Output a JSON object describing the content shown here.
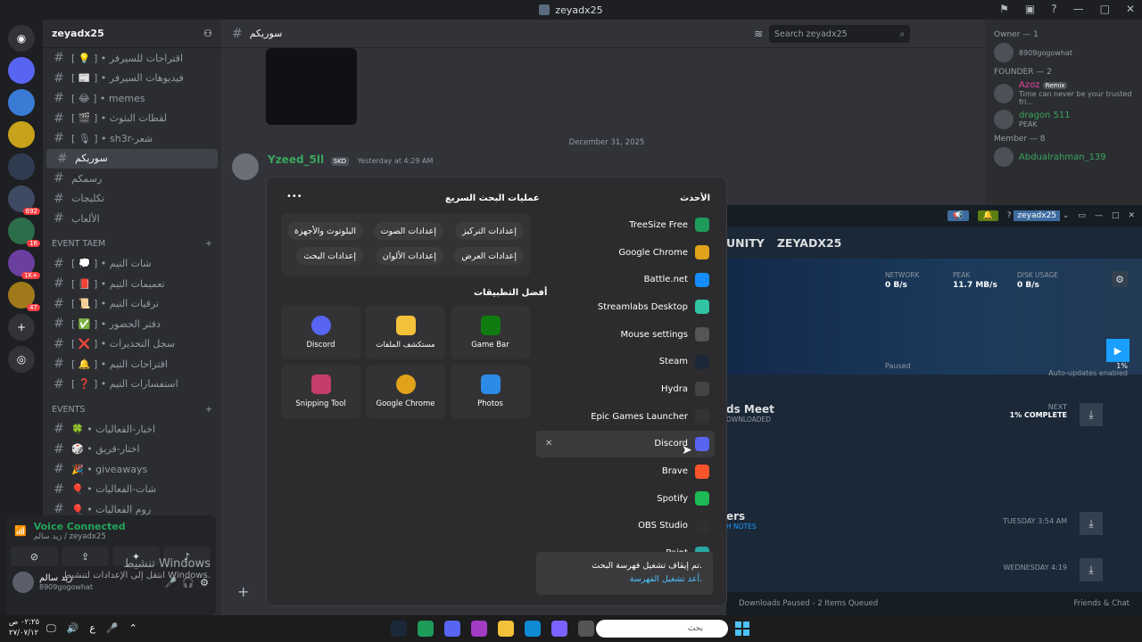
{
  "title_bar": {
    "title": "zeyadx25"
  },
  "guild": {
    "name": "zeyadx25"
  },
  "servers": [
    {
      "label": "",
      "badge": ""
    },
    {
      "label": "",
      "badge": ""
    },
    {
      "label": "",
      "badge": ""
    },
    {
      "label": "",
      "badge": ""
    },
    {
      "label": "",
      "badge": "692"
    },
    {
      "label": "",
      "badge": "16"
    },
    {
      "label": "",
      "badge": "1K+"
    },
    {
      "label": "",
      "badge": "47"
    }
  ],
  "channels": [
    {
      "name": "[ 💡 ] • اقتراحات للسيرفر",
      "active": false
    },
    {
      "name": "[ 📰 ] • فيديوهات السيرفر",
      "active": false
    },
    {
      "name": "[ 😂 ] • memes",
      "active": false
    },
    {
      "name": "[ 🎬 ] • لقطات البثوث",
      "active": false
    },
    {
      "name": "[ 🎙 ] • sh3r-شعر",
      "active": false
    },
    {
      "name": "سوريكم",
      "active": true
    },
    {
      "name": "رسمكم",
      "active": false
    },
    {
      "name": "تكليجات",
      "active": false
    },
    {
      "name": "الألعاب",
      "active": false
    }
  ],
  "event_team_category": "EVENT TAEM",
  "event_team_channels": [
    {
      "name": "[ 💭 ] • شات التيم"
    },
    {
      "name": "[ 📕 ] • تعميمات التيم"
    },
    {
      "name": "[ 📜 ] • ترقيات التيم"
    },
    {
      "name": "[ ✅ ] • دفتر الحضور"
    },
    {
      "name": "[ ❌ ] • سجل التحذيرات"
    },
    {
      "name": "[ 🔔 ] • اقتراحات التيم"
    },
    {
      "name": "[ ❓ ] • استفسارات التيم"
    }
  ],
  "events_category": "EVENTS",
  "events_channels": [
    {
      "name": "🍀 • اخبار-الفعاليات"
    },
    {
      "name": "🎲 • اختار-فريق"
    },
    {
      "name": "🎉 • giveaways"
    },
    {
      "name": "🎈 • شات-الفعاليات"
    },
    {
      "name": "🎈 • روم الفعاليات"
    }
  ],
  "voice": {
    "status": "Voice Connected",
    "sub": "زيد سالم / zeyadx25"
  },
  "user": {
    "name": "زيد سالم",
    "tag": "8909gogowhat"
  },
  "watermark": {
    "line1": "تنشيط Windows",
    "line2": "انتقل إلى الإعدادات لتنشيط Windows."
  },
  "chat": {
    "channel": "سوريكم",
    "search_placeholder": "Search zeyadx25",
    "date_divider": "December 31, 2025",
    "message": {
      "author": "Yzeed_5ll",
      "tag": "SKD",
      "time": "Yesterday at 4:29 AM"
    }
  },
  "members": {
    "owner_cat": "Owner — 1",
    "owner": {
      "name": "",
      "sub": "8909gogowhat"
    },
    "founder_cat": "FOUNDER — 2",
    "founders": [
      {
        "name": "Azoz",
        "sub": "Time can never be your trusted fri...",
        "color": "#eb459e",
        "badge": "Remix"
      },
      {
        "name": "dragon 511",
        "sub": "PEAK",
        "color": "#3ba55d",
        "badge": ""
      }
    ],
    "member_cat": "Member — 8",
    "member_first": {
      "name": "Abdualrahman_139"
    }
  },
  "steam": {
    "account": "zeyadx25",
    "tabs": [
      "UNITY",
      "ZEYADX25"
    ],
    "stats": [
      {
        "label": "NETWORK",
        "value": "0 B/s"
      },
      {
        "label": "PEAK",
        "value": "11.7 MB/s"
      },
      {
        "label": "DISK USAGE",
        "value": "0 B/s"
      }
    ],
    "progress_label": "Paused",
    "progress_pct": "1%",
    "auto_updates": "Auto-updates enabled",
    "item1": {
      "title": "ds Meet",
      "sub": "OWNLOADED",
      "next": "NEXT",
      "complete": "1% COMPLETE"
    },
    "item2": {
      "title": "ers",
      "sub": "H NOTES",
      "time": "TUESDAY 3:54 AM"
    },
    "item3": {
      "time": "WEDNESDAY 4:19"
    },
    "footer_status": "Downloads Paused - 2 Items Queued",
    "footer_friends": "Friends & Chat"
  },
  "start_menu": {
    "recent_title": "الأحدث",
    "quick_title": "عمليات البحث السريع",
    "top_apps_title": "أفضل التطبيقات",
    "recent": [
      {
        "name": "TreeSize Free",
        "color": "#1e9c5a"
      },
      {
        "name": "Google Chrome",
        "color": "#e0a21a"
      },
      {
        "name": "Battle.net",
        "color": "#148eff"
      },
      {
        "name": "Streamlabs Desktop",
        "color": "#31c3a2"
      },
      {
        "name": "Mouse settings",
        "color": "#555"
      },
      {
        "name": "Steam",
        "color": "#1b2838"
      },
      {
        "name": "Hydra",
        "color": "#444"
      },
      {
        "name": "Epic Games Launcher",
        "color": "#333"
      },
      {
        "name": "Discord",
        "color": "#5865f2"
      },
      {
        "name": "Brave",
        "color": "#fb542b"
      },
      {
        "name": "Spotify",
        "color": "#1db954"
      },
      {
        "name": "OBS Studio",
        "color": "#302e31"
      },
      {
        "name": "Paint",
        "color": "#2aa7a0"
      }
    ],
    "quick_searches": [
      "إعدادات التركيز",
      "إعدادات الصوت",
      "البلوتوث والأجهزة",
      "إعدادات العرض",
      "إعدادات الألوان",
      "إعدادات البحث"
    ],
    "top_apps": [
      {
        "name": "Game Bar",
        "color": "#107c10"
      },
      {
        "name": "مستكشف الملفات",
        "color": "#f3c13a"
      },
      {
        "name": "Discord",
        "color": "#5865f2"
      },
      {
        "name": "Photos",
        "color": "#2c8be6"
      },
      {
        "name": "Google Chrome",
        "color": "#e0a21a"
      },
      {
        "name": "Snipping Tool",
        "color": "#c43e6a"
      }
    ],
    "notice": {
      "text": "تم إيقاف تشغيل فهرسة البحث.",
      "link": "أعد تشغيل الفهرسة."
    }
  },
  "taskbar": {
    "time": "٠٢:٢٥ ص",
    "date": "٢٧/٠٧/١٢",
    "lang": "ع",
    "search": "بحث"
  }
}
